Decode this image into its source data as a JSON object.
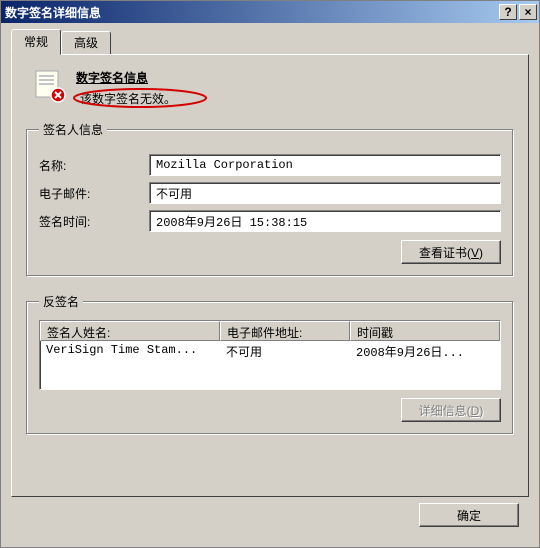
{
  "window": {
    "title": "数字签名详细信息",
    "help_symbol": "?",
    "close_symbol": "×"
  },
  "tabs": {
    "general": "常规",
    "advanced": "高级"
  },
  "signature_info": {
    "heading": "数字签名信息",
    "status": "该数字签名无效。"
  },
  "signer_group": {
    "legend": "签名人信息",
    "name_label": "名称:",
    "name_value": "Mozilla Corporation",
    "email_label": "电子邮件:",
    "email_value": "不可用",
    "time_label": "签名时间:",
    "time_value": "2008年9月26日 15:38:15",
    "view_cert_prefix": "查看证书(",
    "view_cert_accel": "V",
    "view_cert_suffix": ")"
  },
  "counter_group": {
    "legend": "反签名",
    "columns": {
      "name": "签名人姓名:",
      "email": "电子邮件地址:",
      "timestamp": "时间戳"
    },
    "row": {
      "name": "VeriSign Time Stam...",
      "email": "不可用",
      "timestamp": "2008年9月26日..."
    },
    "details_prefix": "详细信息(",
    "details_accel": "D",
    "details_suffix": ")"
  },
  "bottom": {
    "ok": "确定"
  }
}
